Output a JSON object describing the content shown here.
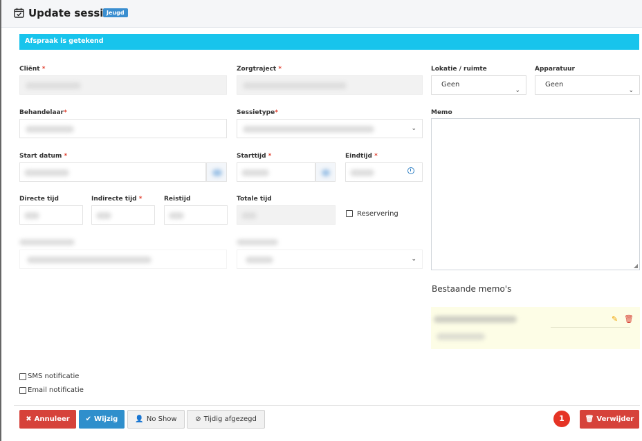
{
  "header": {
    "title": "Update sessie",
    "badge": "Jeugd"
  },
  "alert": {
    "text": "Afspraak is getekend"
  },
  "fields": {
    "client_label": "Cliënt",
    "zorgtraject_label": "Zorgtraject",
    "lokatie_label": "Lokatie / ruimte",
    "apparatuur_label": "Apparatuur",
    "behandelaar_label": "Behandelaar",
    "sessietype_label": "Sessietype",
    "memo_label": "Memo",
    "start_datum_label": "Start datum",
    "starttijd_label": "Starttijd",
    "eindtijd_label": "Eindtijd",
    "directe_tijd_label": "Directe tijd",
    "indirecte_tijd_label": "Indirecte tijd",
    "reistijd_label": "Reistijd",
    "totale_tijd_label": "Totale tijd",
    "reservering_label": "Reservering",
    "required_mark": "*"
  },
  "selects": {
    "lokatie_value": "Geen",
    "apparatuur_value": "Geen"
  },
  "memos": {
    "section_title": "Bestaande memo's"
  },
  "notifications": {
    "sms_label": "SMS notificatie",
    "email_label": "Email notificatie"
  },
  "buttons": {
    "annuleer": "Annuleer",
    "wijzig": "Wijzig",
    "no_show": "No Show",
    "tijdig_afgezegd": "Tijdig afgezegd",
    "verwijder": "Verwijder",
    "badge_count": "1"
  },
  "colors": {
    "danger": "#d6423a",
    "primary": "#2f8fcc",
    "info": "#18c4ec",
    "badge": "#3a8ed0"
  }
}
